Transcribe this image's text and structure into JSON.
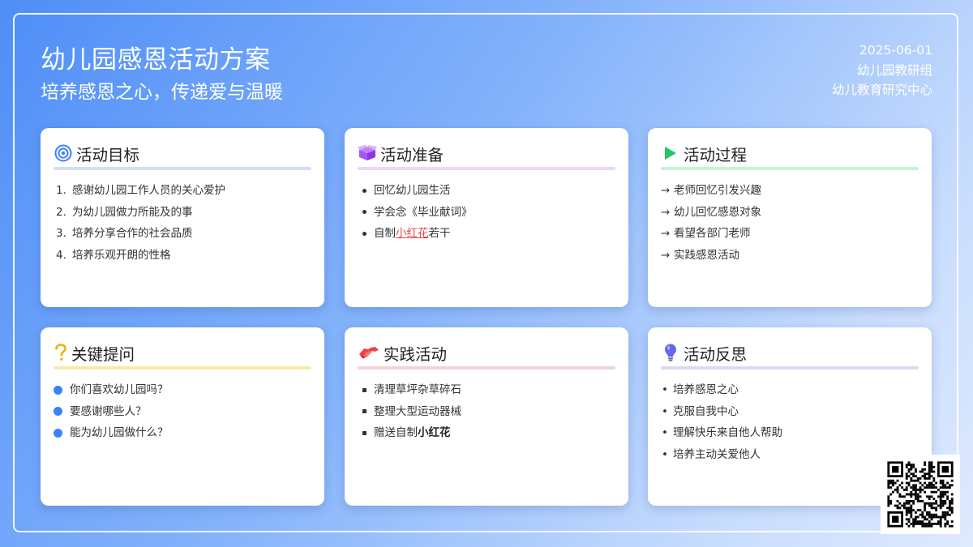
{
  "header": {
    "title": "幼儿园感恩活动方案",
    "subtitle": "培养感恩之心，传递爱与温暖",
    "date": "2025-06-01",
    "org1": "幼儿园教研组",
    "org2": "幼儿教育研究中心"
  },
  "colors": {
    "goal_rule": "#cfe0f7",
    "prep_rule": "#ead8f7",
    "process_rule": "#c9f1d6",
    "question_rule": "#fbe9a8",
    "practice_rule": "#f5d2d2",
    "reflect_rule": "#d7dcf2",
    "accent_red": "#e5484d",
    "accent_blue": "#3b82f6"
  },
  "cards": {
    "goal": {
      "icon": "target-icon",
      "title": "活动目标",
      "items": [
        {
          "marker": "1.",
          "text": "感谢幼儿园工作人员的关心爱护"
        },
        {
          "marker": "2.",
          "text": "为幼儿园做力所能及的事"
        },
        {
          "marker": "3.",
          "text": "培养分享合作的社会品质"
        },
        {
          "marker": "4.",
          "text": "培养乐观开朗的性格"
        }
      ]
    },
    "prep": {
      "icon": "box-icon",
      "title": "活动准备",
      "items": [
        {
          "text": "回忆幼儿园生活"
        },
        {
          "text": "学会念《毕业献词》"
        },
        {
          "pre": "自制",
          "hl": "小红花",
          "post": "若干"
        }
      ]
    },
    "process": {
      "icon": "play-icon",
      "title": "活动过程",
      "items": [
        {
          "marker": "→",
          "text": "老师回忆引发兴趣"
        },
        {
          "marker": "→",
          "text": "幼儿回忆感恩对象"
        },
        {
          "marker": "→",
          "text": "看望各部门老师"
        },
        {
          "marker": "→",
          "text": "实践感恩活动"
        }
      ]
    },
    "question": {
      "icon": "question-icon",
      "title": "关键提问",
      "items": [
        {
          "text": "你们喜欢幼儿园吗？"
        },
        {
          "text": "要感谢哪些人？"
        },
        {
          "text": "能为幼儿园做什么？"
        }
      ]
    },
    "practice": {
      "icon": "handshake-icon",
      "title": "实践活动",
      "items": [
        {
          "text": "清理草坪杂草碎石"
        },
        {
          "text": "整理大型运动器械"
        },
        {
          "pre": "赠送自制",
          "bold": "小红花"
        }
      ]
    },
    "reflect": {
      "icon": "lightbulb-icon",
      "title": "活动反思",
      "items": [
        {
          "marker": "•",
          "text": "培养感恩之心"
        },
        {
          "marker": "•",
          "text": "克服自我中心"
        },
        {
          "marker": "•",
          "text": "理解快乐来自他人帮助"
        },
        {
          "marker": "•",
          "text": "培养主动关爱他人"
        }
      ]
    }
  },
  "qr": {
    "icon": "qr-code-icon"
  }
}
